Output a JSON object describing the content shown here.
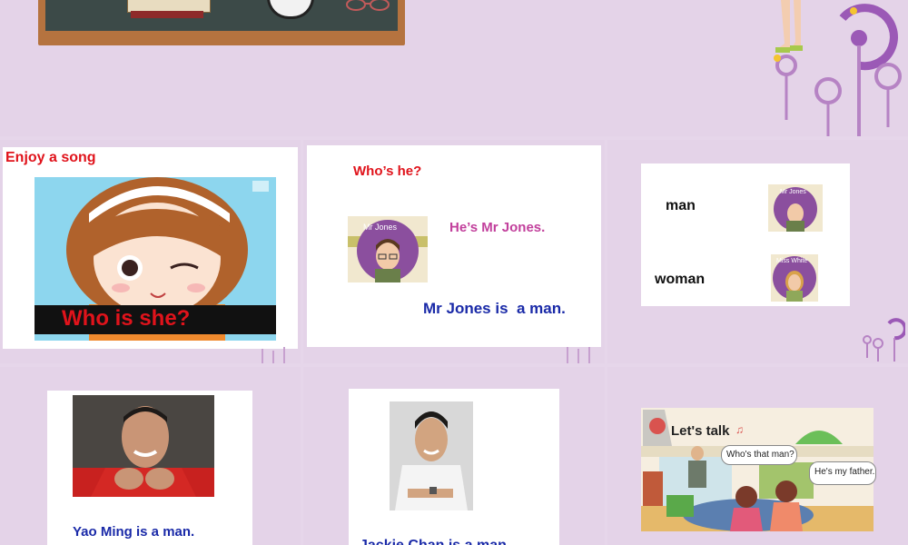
{
  "slide1": {
    "heading": "Enjoy a song",
    "banner": "Who is she?"
  },
  "slide2": {
    "question": "Who’s he?",
    "answer": "He’s Mr Jones.",
    "statement": "Mr Jones is  a man.",
    "portrait_label": "Mr Jones"
  },
  "slide3": {
    "word_man": "man",
    "word_woman": "woman",
    "label_man": "Mr Jones",
    "label_woman": "Miss White"
  },
  "slide4": {
    "caption": "Yao Ming is a man."
  },
  "slide5": {
    "caption": "Jackie Chan is a man."
  },
  "slide6": {
    "title": "Let's talk",
    "bubble1": "Who's that man?",
    "bubble2": "He's my father."
  },
  "colors": {
    "background": "#e6d6ea",
    "red": "#e0131b",
    "magenta": "#c2409c",
    "navy": "#1a2aa8",
    "deco_purple": "#9b59b6"
  }
}
